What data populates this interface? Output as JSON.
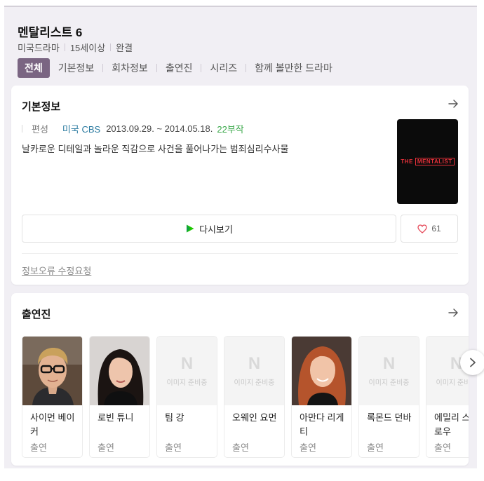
{
  "header": {
    "title": "멘탈리스트 6",
    "meta": [
      "미국드라마",
      "15세이상",
      "완결"
    ]
  },
  "tabs": [
    {
      "label": "전체",
      "active": true
    },
    {
      "label": "기본정보",
      "active": false
    },
    {
      "label": "회차정보",
      "active": false
    },
    {
      "label": "출연진",
      "active": false
    },
    {
      "label": "시리즈",
      "active": false
    },
    {
      "label": "함께 볼만한 드라마",
      "active": false
    }
  ],
  "basic_info": {
    "title": "기본정보",
    "label": "편성",
    "network": "미국 CBS",
    "dates": "2013.09.29. ~ 2014.05.18.",
    "episodes": "22부작",
    "description": "날카로운 디테일과 놀라운 직감으로 사건을 풀어나가는 범죄심리수사물",
    "poster_text_1": "THE",
    "poster_text_2": "MENTALIST",
    "watch_label": "다시보기",
    "like_count": "61",
    "report_label": "정보오류 수정요청"
  },
  "cast": {
    "title": "출연진",
    "members": [
      {
        "name": "사이먼 베이커",
        "role": "출연",
        "photo": "photo"
      },
      {
        "name": "로빈 튜니",
        "role": "출연",
        "photo": "photo"
      },
      {
        "name": "팀 강",
        "role": "출연",
        "photo": "none"
      },
      {
        "name": "오웨인 요먼",
        "role": "출연",
        "photo": "none"
      },
      {
        "name": "아만다 리게티",
        "role": "출연",
        "photo": "photo"
      },
      {
        "name": "록몬드 던바",
        "role": "출연",
        "photo": "none"
      },
      {
        "name": "에밀리 스왈로우",
        "role": "출연",
        "photo": "none"
      }
    ],
    "no_image_mark": "N",
    "no_image_text": "이미지 준비중"
  },
  "colors": {
    "active_tab": "#7a6582",
    "network": "#2a7aa0",
    "episodes": "#3aa84a",
    "poster_red": "#e8313a"
  },
  "icons": [
    "arrow-right-icon",
    "play-icon",
    "heart-icon",
    "chevron-right-icon",
    "n-logo-icon"
  ]
}
